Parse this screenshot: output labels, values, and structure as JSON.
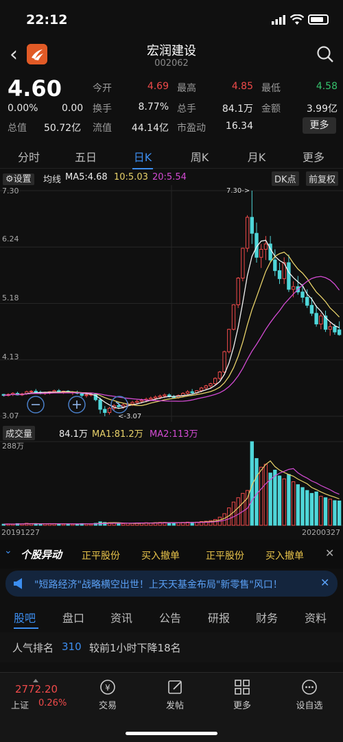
{
  "status": {
    "time": "22:12"
  },
  "header": {
    "title": "宏润建设",
    "code": "002062"
  },
  "quote": {
    "price": "4.60",
    "change_pct": "0.00%",
    "change": "0.00",
    "rows": [
      [
        {
          "l": "今开",
          "v": "4.69",
          "c": "red"
        },
        {
          "l": "最高",
          "v": "4.85",
          "c": "red"
        },
        {
          "l": "最低",
          "v": "4.58",
          "c": "green"
        }
      ],
      [
        {
          "l": "换手",
          "v": "8.77%"
        },
        {
          "l": "总手",
          "v": "84.1万"
        },
        {
          "l": "金额",
          "v": "3.99亿"
        }
      ],
      [
        {
          "l": "流值",
          "v": "44.14亿"
        },
        {
          "l": "市盈动",
          "v": "16.34"
        }
      ]
    ],
    "total_value_label": "总值",
    "total_value": "50.72亿",
    "more": "更多"
  },
  "tabs": [
    "分时",
    "五日",
    "日K",
    "周K",
    "月K",
    "更多"
  ],
  "active_tab": "日K",
  "chart_toolbar": {
    "settings": "设置",
    "ma_label": "均线",
    "ma5": "MA5:4.68",
    "ma10": "10:5.03",
    "ma20": "20:5.54",
    "dk": "DK点",
    "adjust": "前复权"
  },
  "vol_toolbar": {
    "label": "成交量",
    "vol": "84.1万",
    "ma1": "MA1:81.2万",
    "ma2": "MA2:113万"
  },
  "ticker": {
    "title": "个股异动",
    "items": [
      "正平股份",
      "买入撤单",
      "正平股份",
      "买入撤单"
    ]
  },
  "banner": {
    "text": "\"短路经济\"战略横空出世！上天天基金布局\"新零售\"风口！"
  },
  "subtabs": [
    "股吧",
    "盘口",
    "资讯",
    "公告",
    "研报",
    "财务",
    "资料"
  ],
  "rank": {
    "label": "人气排名",
    "value": "310",
    "desc": "较前1小时下降18名"
  },
  "index": {
    "value": "2772.20",
    "name": "上证",
    "pct": "0.26%"
  },
  "bottom_nav": [
    "交易",
    "发帖",
    "更多",
    "设自选"
  ],
  "chart_data": {
    "type": "candlestick",
    "y_ticks": [
      "7.30",
      "6.24",
      "5.18",
      "4.13",
      "3.07"
    ],
    "vol_max_label": "288万",
    "x_start": "20191227",
    "x_end": "20200327",
    "annotations": [
      "7.30->",
      "<-3.07"
    ],
    "ohlc": [
      [
        3.48,
        3.49,
        3.44,
        3.46
      ],
      [
        3.46,
        3.5,
        3.44,
        3.48
      ],
      [
        3.48,
        3.52,
        3.45,
        3.5
      ],
      [
        3.5,
        3.53,
        3.46,
        3.47
      ],
      [
        3.47,
        3.51,
        3.45,
        3.49
      ],
      [
        3.49,
        3.55,
        3.47,
        3.53
      ],
      [
        3.53,
        3.56,
        3.5,
        3.54
      ],
      [
        3.54,
        3.58,
        3.51,
        3.52
      ],
      [
        3.52,
        3.55,
        3.48,
        3.5
      ],
      [
        3.5,
        3.53,
        3.47,
        3.51
      ],
      [
        3.51,
        3.54,
        3.48,
        3.53
      ],
      [
        3.53,
        3.57,
        3.5,
        3.55
      ],
      [
        3.55,
        3.58,
        3.51,
        3.52
      ],
      [
        3.52,
        3.55,
        3.49,
        3.54
      ],
      [
        3.54,
        3.56,
        3.5,
        3.51
      ],
      [
        3.51,
        3.54,
        3.47,
        3.52
      ],
      [
        3.52,
        3.55,
        3.48,
        3.5
      ],
      [
        3.5,
        3.52,
        3.43,
        3.46
      ],
      [
        3.46,
        3.49,
        3.42,
        3.47
      ],
      [
        3.47,
        3.5,
        3.44,
        3.48
      ],
      [
        3.48,
        3.49,
        3.35,
        3.38
      ],
      [
        3.38,
        3.42,
        3.12,
        3.2
      ],
      [
        3.2,
        3.26,
        3.07,
        3.14
      ],
      [
        3.14,
        3.25,
        3.1,
        3.22
      ],
      [
        3.22,
        3.3,
        3.18,
        3.27
      ],
      [
        3.27,
        3.33,
        3.22,
        3.25
      ],
      [
        3.25,
        3.31,
        3.21,
        3.28
      ],
      [
        3.28,
        3.34,
        3.24,
        3.3
      ],
      [
        3.3,
        3.36,
        3.26,
        3.33
      ],
      [
        3.33,
        3.38,
        3.29,
        3.35
      ],
      [
        3.35,
        3.4,
        3.31,
        3.37
      ],
      [
        3.37,
        3.42,
        3.33,
        3.39
      ],
      [
        3.39,
        3.44,
        3.35,
        3.41
      ],
      [
        3.41,
        3.46,
        3.37,
        3.43
      ],
      [
        3.43,
        3.48,
        3.39,
        3.45
      ],
      [
        3.45,
        3.5,
        3.41,
        3.47
      ],
      [
        3.47,
        3.5,
        3.42,
        3.44
      ],
      [
        3.44,
        3.47,
        3.4,
        3.42
      ],
      [
        3.42,
        3.48,
        3.4,
        3.46
      ],
      [
        3.46,
        3.52,
        3.43,
        3.5
      ],
      [
        3.5,
        3.56,
        3.47,
        3.53
      ],
      [
        3.53,
        3.58,
        3.49,
        3.51
      ],
      [
        3.51,
        3.56,
        3.48,
        3.55
      ],
      [
        3.55,
        3.62,
        3.52,
        3.6
      ],
      [
        3.6,
        3.66,
        3.56,
        3.64
      ],
      [
        3.64,
        3.7,
        3.6,
        3.68
      ],
      [
        3.68,
        3.8,
        3.65,
        3.78
      ],
      [
        3.78,
        3.92,
        3.75,
        3.9
      ],
      [
        3.9,
        4.3,
        3.88,
        4.28
      ],
      [
        4.28,
        4.71,
        4.25,
        4.7
      ],
      [
        4.7,
        5.17,
        4.68,
        5.16
      ],
      [
        5.16,
        5.68,
        5.1,
        5.66
      ],
      [
        5.66,
        6.23,
        5.6,
        6.22
      ],
      [
        6.22,
        6.84,
        6.15,
        6.8
      ],
      [
        6.8,
        7.3,
        6.3,
        6.5
      ],
      [
        6.5,
        6.7,
        5.95,
        6.05
      ],
      [
        6.05,
        6.3,
        5.85,
        6.2
      ],
      [
        6.2,
        6.45,
        6.0,
        6.3
      ],
      [
        6.3,
        6.45,
        5.95,
        6.0
      ],
      [
        6.0,
        6.2,
        5.7,
        5.8
      ],
      [
        5.8,
        5.95,
        5.55,
        5.65
      ],
      [
        5.65,
        6.05,
        5.55,
        5.95
      ],
      [
        5.95,
        6.1,
        5.4,
        5.45
      ],
      [
        5.45,
        5.6,
        5.3,
        5.5
      ],
      [
        5.5,
        5.7,
        5.35,
        5.4
      ],
      [
        5.4,
        5.55,
        5.2,
        5.3
      ],
      [
        5.3,
        5.45,
        5.1,
        5.15
      ],
      [
        5.15,
        5.3,
        4.95,
        5.0
      ],
      [
        5.0,
        5.15,
        4.75,
        4.8
      ],
      [
        4.8,
        5.0,
        4.7,
        4.95
      ],
      [
        4.95,
        5.05,
        4.65,
        4.7
      ],
      [
        4.7,
        4.85,
        4.58,
        4.75
      ],
      [
        4.75,
        4.8,
        4.6,
        4.65
      ],
      [
        4.69,
        4.85,
        4.58,
        4.6
      ]
    ],
    "volume": [
      4,
      5,
      4,
      6,
      5,
      7,
      6,
      5,
      4,
      5,
      6,
      6,
      5,
      4,
      5,
      4,
      5,
      6,
      5,
      4,
      7,
      12,
      10,
      9,
      8,
      6,
      6,
      7,
      7,
      8,
      8,
      9,
      8,
      9,
      10,
      10,
      9,
      8,
      9,
      10,
      11,
      10,
      11,
      13,
      14,
      16,
      20,
      28,
      40,
      60,
      80,
      95,
      110,
      120,
      288,
      230,
      200,
      210,
      180,
      190,
      170,
      160,
      175,
      150,
      140,
      130,
      120,
      110,
      115,
      100,
      95,
      90,
      85,
      84
    ]
  }
}
